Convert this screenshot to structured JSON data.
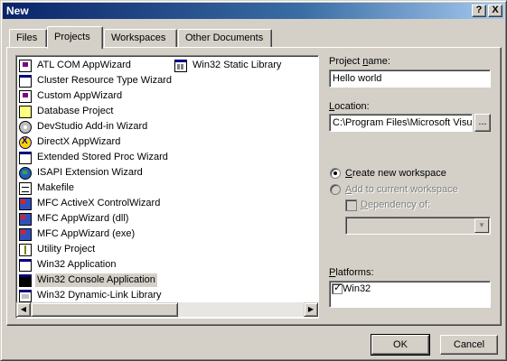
{
  "window": {
    "title": "New",
    "help_glyph": "?",
    "close_glyph": "X"
  },
  "tabs": [
    {
      "label": "Files",
      "active": false
    },
    {
      "label": "Projects",
      "active": true
    },
    {
      "label": "Workspaces",
      "active": false
    },
    {
      "label": "Other Documents",
      "active": false
    }
  ],
  "project_types": [
    {
      "label": "ATL COM AppWizard",
      "icon": "atl-wizard-icon"
    },
    {
      "label": "Cluster Resource Type Wizard",
      "icon": "cluster-wizard-icon"
    },
    {
      "label": "Custom AppWizard",
      "icon": "custom-wizard-icon"
    },
    {
      "label": "Database Project",
      "icon": "database-icon"
    },
    {
      "label": "DevStudio Add-in Wizard",
      "icon": "gear-icon"
    },
    {
      "label": "DirectX AppWizard",
      "icon": "directx-icon"
    },
    {
      "label": "Extended Stored Proc Wizard",
      "icon": "stored-proc-icon"
    },
    {
      "label": "ISAPI Extension Wizard",
      "icon": "globe-icon"
    },
    {
      "label": "Makefile",
      "icon": "makefile-icon"
    },
    {
      "label": "MFC ActiveX ControlWizard",
      "icon": "mfc-activex-icon"
    },
    {
      "label": "MFC AppWizard (dll)",
      "icon": "mfc-dll-icon"
    },
    {
      "label": "MFC AppWizard (exe)",
      "icon": "mfc-exe-icon"
    },
    {
      "label": "Utility Project",
      "icon": "utility-icon"
    },
    {
      "label": "Win32 Application",
      "icon": "win32-app-icon"
    },
    {
      "label": "Win32 Console Application",
      "icon": "console-icon",
      "selected": true
    },
    {
      "label": "Win32 Dynamic-Link Library",
      "icon": "dll-icon"
    },
    {
      "label": "Win32 Static Library",
      "icon": "static-lib-icon"
    }
  ],
  "scrollbar": {
    "left_glyph": "◀",
    "right_glyph": "▶"
  },
  "form": {
    "project_name_label_pre": "Project ",
    "project_name_label_ul": "n",
    "project_name_label_post": "ame:",
    "project_name_value": "Hello world",
    "location_label_ul": "L",
    "location_label_post": "ocation:",
    "location_value": "C:\\Program Files\\Microsoft Visua",
    "browse_label": "...",
    "create_ws_ul": "C",
    "create_ws_post": "reate new workspace",
    "add_ws_ul": "A",
    "add_ws_post": "dd to current workspace",
    "dependency_ul": "D",
    "dependency_post": "ependency of:",
    "dependency_value": "",
    "dropdown_glyph": "▼",
    "platforms_label_ul": "P",
    "platforms_label_post": "latforms:",
    "platforms": [
      {
        "label": "Win32",
        "checked": true
      }
    ]
  },
  "buttons": {
    "ok": "OK",
    "cancel": "Cancel"
  }
}
